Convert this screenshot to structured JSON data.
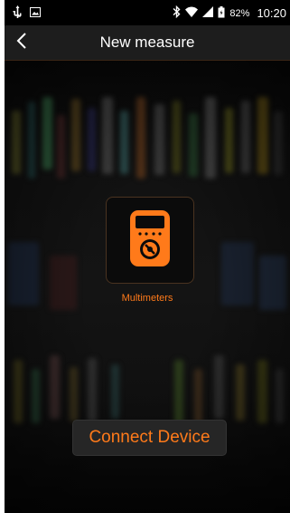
{
  "status_bar": {
    "battery_percent": "82%",
    "time": "10:20",
    "icons": [
      "usb-icon",
      "image-icon",
      "bluetooth-icon",
      "wifi-icon",
      "signal-icon",
      "battery-icon"
    ]
  },
  "app_bar": {
    "title": "New measure",
    "back_icon": "chevron-left-icon"
  },
  "device": {
    "label": "Multimeters",
    "icon": "multimeter-icon"
  },
  "connect_button": {
    "label": "Connect Device"
  },
  "colors": {
    "accent": "#ff7a1a",
    "app_bar_bg": "#1d1d1d",
    "button_bg": "#262626"
  }
}
